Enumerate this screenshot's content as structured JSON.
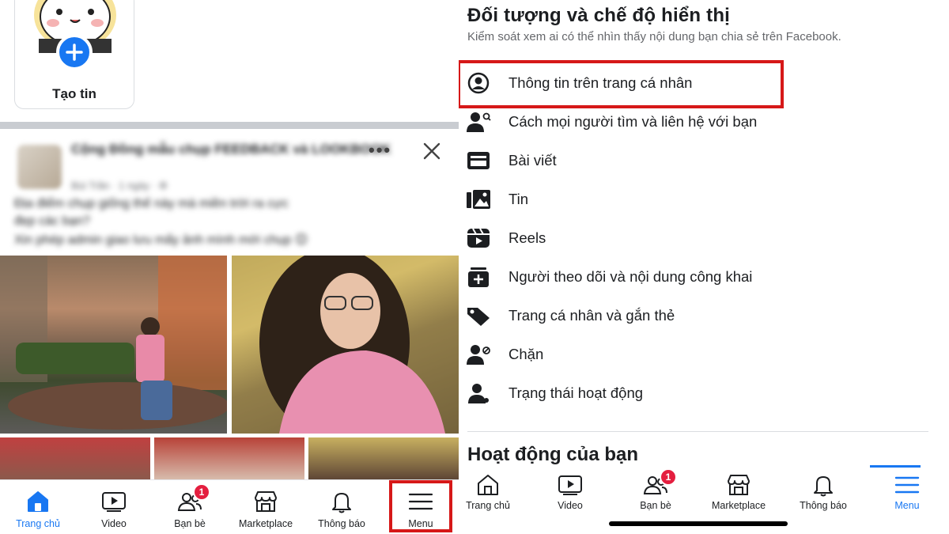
{
  "left": {
    "story": {
      "label": "Tạo tin"
    },
    "post": {
      "group_name": "Cộng Đồng mẫu chụp FEEDBACK và LOOKBOOK",
      "meta": "Bùi Trần · 1 ngày · ⚙",
      "body_line1": "Địa điểm chụp giống thế này mà miền trời ra cực",
      "body_line2": "đẹp các bạn?",
      "body_line3": "Xin phép admin giao lưu mấy ảnh mình mới chụp 😊"
    },
    "nav": [
      {
        "label": "Trang chủ",
        "icon": "home-icon",
        "active": true
      },
      {
        "label": "Video",
        "icon": "video-icon",
        "active": false
      },
      {
        "label": "Bạn bè",
        "icon": "friends-icon",
        "active": false,
        "badge": "1"
      },
      {
        "label": "Marketplace",
        "icon": "marketplace-icon",
        "active": false
      },
      {
        "label": "Thông báo",
        "icon": "bell-icon",
        "active": false
      },
      {
        "label": "Menu",
        "icon": "menu-icon",
        "active": false
      }
    ]
  },
  "right": {
    "section_title": "Đối tượng và chế độ hiển thị",
    "section_sub": "Kiểm soát xem ai có thể nhìn thấy nội dung bạn chia sẻ trên Facebook.",
    "items": [
      {
        "label": "Thông tin trên trang cá nhân",
        "icon": "profile-circle-icon"
      },
      {
        "label": "Cách mọi người tìm và liên hệ với bạn",
        "icon": "person-search-icon"
      },
      {
        "label": "Bài viết",
        "icon": "post-card-icon"
      },
      {
        "label": "Tin",
        "icon": "story-image-icon"
      },
      {
        "label": "Reels",
        "icon": "reels-icon"
      },
      {
        "label": "Người theo dõi và nội dung công khai",
        "icon": "followers-plus-icon"
      },
      {
        "label": "Trang cá nhân và gắn thẻ",
        "icon": "tag-icon"
      },
      {
        "label": "Chặn",
        "icon": "block-person-icon"
      },
      {
        "label": "Trạng thái hoạt động",
        "icon": "active-status-icon"
      }
    ],
    "section2_title": "Hoạt động của bạn",
    "nav": [
      {
        "label": "Trang chủ",
        "icon": "home-icon",
        "active": false
      },
      {
        "label": "Video",
        "icon": "video-icon",
        "active": false
      },
      {
        "label": "Bạn bè",
        "icon": "friends-icon",
        "active": false,
        "badge": "1"
      },
      {
        "label": "Marketplace",
        "icon": "marketplace-icon",
        "active": false
      },
      {
        "label": "Thông báo",
        "icon": "bell-icon",
        "active": false
      },
      {
        "label": "Menu",
        "icon": "menu-icon",
        "active": true
      }
    ]
  },
  "colors": {
    "accent": "#1877f2",
    "highlight": "#d61818",
    "badge": "#e41e3f",
    "text": "#1c1e21",
    "muted": "#65676b"
  }
}
